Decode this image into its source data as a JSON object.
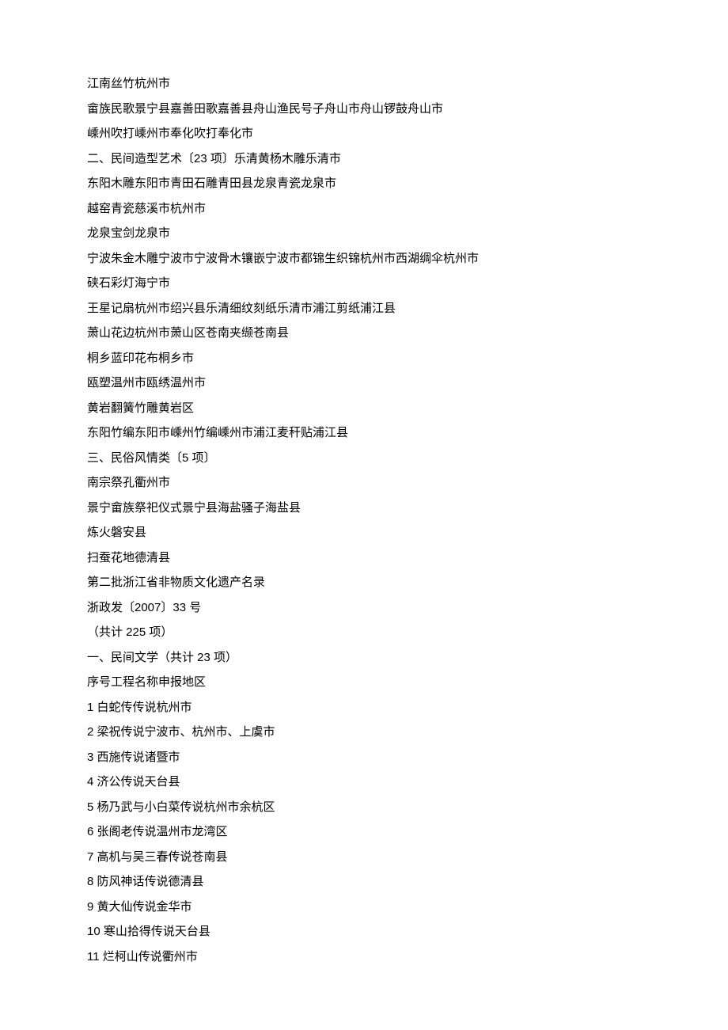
{
  "lines": [
    "江南丝竹杭州市",
    "畲族民歌景宁县嘉善田歌嘉善县舟山渔民号子舟山市舟山锣鼓舟山市",
    "嵊州吹打嵊州市奉化吹打奉化市",
    "二、民间造型艺术〔23 项〕乐清黄杨木雕乐清市",
    "东阳木雕东阳市青田石雕青田县龙泉青瓷龙泉市",
    "越窑青瓷慈溪市杭州市",
    "龙泉宝剑龙泉市",
    "宁波朱金木雕宁波市宁波骨木镶嵌宁波市都锦生织锦杭州市西湖绸伞杭州市",
    "硖石彩灯海宁市",
    "王星记扇杭州市绍兴县乐清细纹刻纸乐清市浦江剪纸浦江县",
    "萧山花边杭州市萧山区苍南夹缬苍南县",
    "桐乡蓝印花布桐乡市",
    "瓯塑温州市瓯绣温州市",
    "黄岩翻簧竹雕黄岩区",
    "东阳竹编东阳市嵊州竹编嵊州市浦江麦秆贴浦江县",
    "三、民俗风情类〔5 项〕",
    "南宗祭孔衢州市",
    "景宁畲族祭祀仪式景宁县海盐骚子海盐县",
    "炼火磐安县",
    "扫蚕花地德清县",
    "第二批浙江省非物质文化遗产名录",
    "浙政发〔2007〕33 号",
    "（共计 225 项）",
    "一、民间文学（共计 23 项）",
    "序号工程名称申报地区",
    "1 白蛇传传说杭州市",
    "2 梁祝传说宁波市、杭州市、上虞市",
    "3 西施传说诸暨市",
    "4 济公传说天台县",
    "5 杨乃武与小白菜传说杭州市余杭区",
    "6 张阁老传说温州市龙湾区",
    "7 高机与吴三春传说苍南县",
    "8 防风神话传说德清县",
    "9 黄大仙传说金华市",
    "10 寒山拾得传说天台县",
    "11 烂柯山传说衢州市"
  ]
}
